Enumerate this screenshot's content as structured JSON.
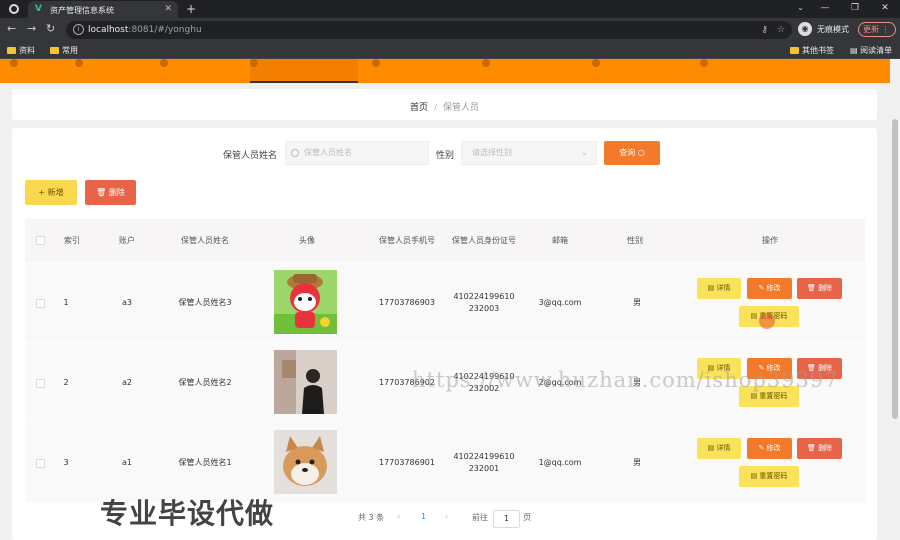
{
  "browser": {
    "tab_title": "资产管理信息系统",
    "url_host": "localhost",
    "url_path": ":8081/#/yonghu",
    "incognito_label": "无痕模式",
    "update_label": "更新",
    "bookmarks": [
      "资料",
      "常用"
    ],
    "bookmarks_right": [
      "其他书签",
      "阅读清单"
    ]
  },
  "breadcrumb": {
    "home": "首页",
    "separator": "/",
    "current": "保管人员"
  },
  "search": {
    "name_label": "保管人员姓名",
    "name_placeholder": "保管人员姓名",
    "gender_label": "性别",
    "gender_placeholder": "请选择性别",
    "query_label": "查询"
  },
  "actions": {
    "add_label": "新增",
    "delete_label": "删除"
  },
  "table": {
    "headers": [
      "索引",
      "账户",
      "保管人员姓名",
      "头像",
      "保管人员手机号",
      "保管人员身份证号",
      "邮箱",
      "性别",
      "操作"
    ],
    "rows": [
      {
        "index": "1",
        "account": "a3",
        "name": "保管人员姓名3",
        "avatar": "cartoon-fox-avatar",
        "phone": "17703786903",
        "id_line1": "410224199610",
        "id_line2": "232003",
        "email": "3@qq.com",
        "gender": "男"
      },
      {
        "index": "2",
        "account": "a2",
        "name": "保管人员姓名2",
        "avatar": "person-photo-avatar",
        "phone": "17703786902",
        "id_line1": "410224199610",
        "id_line2": "232002",
        "email": "2@qq.com",
        "gender": "男"
      },
      {
        "index": "3",
        "account": "a1",
        "name": "保管人员姓名1",
        "avatar": "shiba-dog-avatar",
        "phone": "17703786901",
        "id_line1": "410224199610",
        "id_line2": "232001",
        "email": "1@qq.com",
        "gender": "男"
      }
    ],
    "row_buttons": {
      "detail": "详情",
      "edit": "修改",
      "delete": "删除",
      "reset": "重置密码"
    }
  },
  "pagination": {
    "total": "共 3 条",
    "prev": "‹",
    "page": "1",
    "next": "›",
    "goto_label": "前往",
    "goto_value": "1",
    "page_unit": "页"
  },
  "watermark": "https://www.huzhan.com/ishop39397",
  "overlay_caption": "专业毕设代做",
  "colors": {
    "nav_bg": "#ff8c00",
    "query_btn": "#f27a2a",
    "add_btn": "#fad84d",
    "delete_btn": "#e86448"
  }
}
